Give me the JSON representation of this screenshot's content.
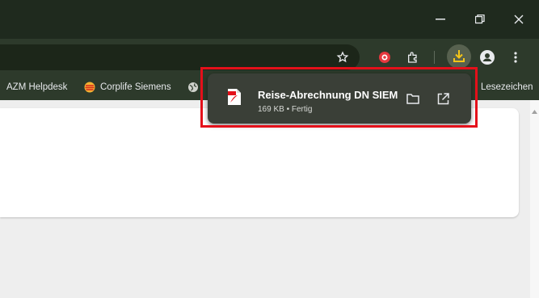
{
  "window": {
    "controls": {
      "minimize_icon": "minimize-icon",
      "restore_icon": "restore-icon",
      "close_icon": "close-icon"
    }
  },
  "toolbar": {
    "icons": [
      "star-icon",
      "extension-record-icon",
      "extensions-puzzle-icon",
      "download-icon",
      "profile-icon",
      "more-menu-icon"
    ]
  },
  "bookmarks": {
    "items": [
      {
        "label": "AZM Helpdesk"
      },
      {
        "label": "Corplife Siemens"
      },
      {
        "label": ""
      }
    ],
    "all_bookmarks_label": "Lesezeichen"
  },
  "download": {
    "file_name": "Reise-Abrechnung DN SIEM",
    "file_meta": "169 KB • Fertig",
    "actions": [
      "folder-icon",
      "open-external-icon"
    ]
  },
  "colors": {
    "titlebar": "#1f2a1e",
    "toolbar": "#2d3a2b",
    "bubble": "#3a3f37",
    "highlight": "#e4101a",
    "download_active": "#f5c518"
  }
}
